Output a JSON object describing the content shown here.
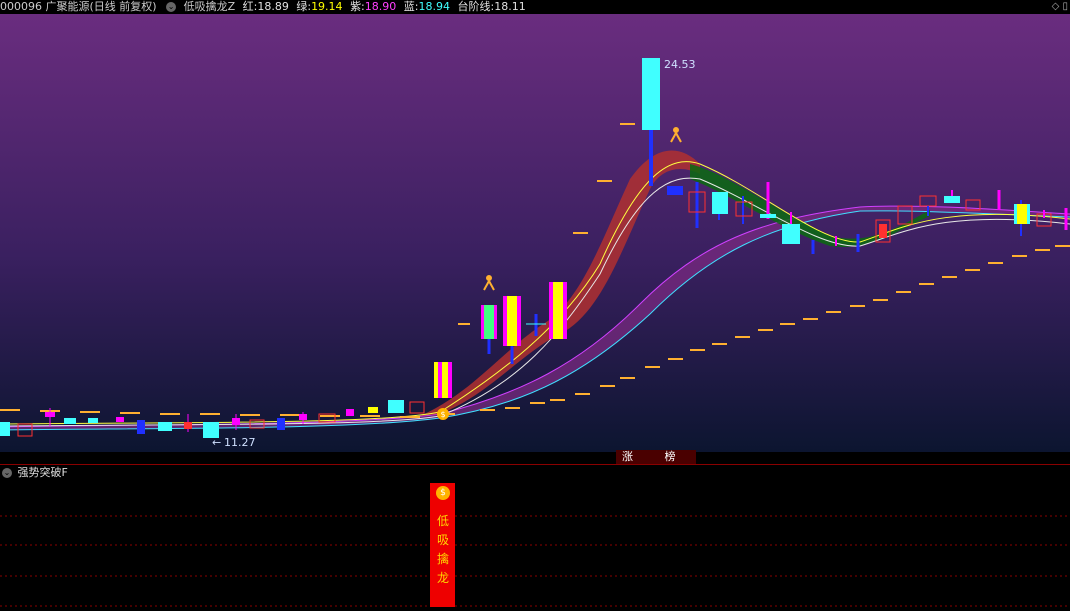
{
  "header": {
    "code_name": "000096 广聚能源(日线 前复权)",
    "indicator_name": "低吸擒龙Z",
    "values": [
      {
        "label": "红:",
        "value": "18.89",
        "color": "#e0e0e0"
      },
      {
        "label": "绿:",
        "value": "19.14",
        "color": "#ffff00"
      },
      {
        "label": "紫:",
        "value": "18.90",
        "color": "#ff40ff"
      },
      {
        "label": "蓝:",
        "value": "18.94",
        "color": "#40ffff"
      },
      {
        "label": "台阶线:",
        "value": "18.11",
        "color": "#e0e0e0"
      }
    ]
  },
  "chart": {
    "high_label": "24.53",
    "low_label": "11.27",
    "badge": "涨 榜",
    "colors": {
      "bg_top": "#6a2d7f",
      "bg_bottom": "#0c1530",
      "up": "#ff00ff",
      "down": "#40ffff",
      "step": "#ffb030"
    }
  },
  "indicator": {
    "title": "强势突破F",
    "signal_text": "低吸擒龙",
    "signal_icon": "money-bag-icon"
  }
}
